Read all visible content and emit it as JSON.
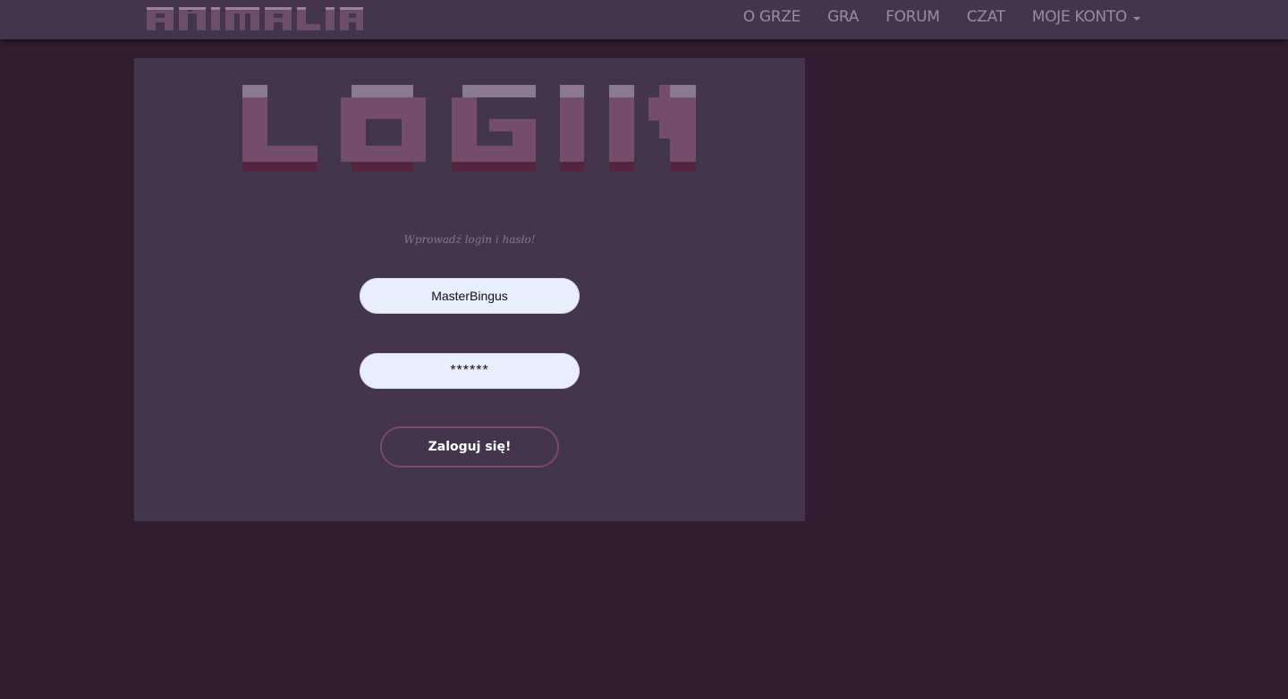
{
  "nav": {
    "brand": "ANIMALIA",
    "items": [
      {
        "label": "O GRZE"
      },
      {
        "label": "GRA"
      },
      {
        "label": "FORUM"
      },
      {
        "label": "CZAT"
      },
      {
        "label": "MOJE KONTO"
      }
    ]
  },
  "login": {
    "title": "LOGIN",
    "prompt": "Wprowadź login i hasło!",
    "username_value": "MasterBingus",
    "password_value": "******",
    "submit_label": "Zaloguj się!"
  },
  "colors": {
    "page_bg": "#311f31",
    "panel_bg": "#43354b",
    "nav_text": "#9a8aa3",
    "title_face": "#744e68",
    "title_top": "#8b7891",
    "title_shadow": "#54233f",
    "button_border": "#7a4a68",
    "input_bg": "#e9edfc"
  }
}
